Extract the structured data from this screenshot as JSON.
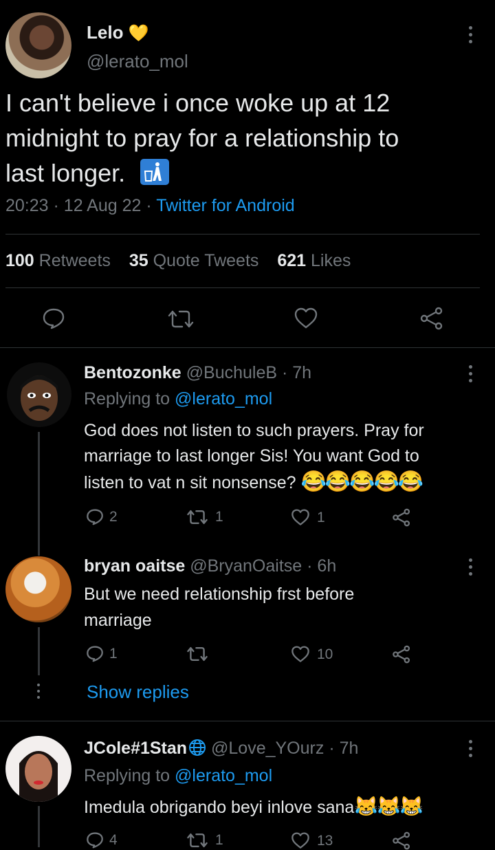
{
  "tweet": {
    "author_name": "Lelo",
    "author_handle": "@lerato_mol",
    "name_emoji": "💛",
    "text_lines": [
      "I can't believe i once woke up at 12",
      "midnight to pray for a relationship to",
      "last longer."
    ],
    "text_emoji": "🚮",
    "time": "20:23",
    "date": "12 Aug 22",
    "sep": "·",
    "source": "Twitter for Android",
    "stats": {
      "retweets_count": "100",
      "retweets_label": "Retweets",
      "quotes_count": "35",
      "quotes_label": "Quote Tweets",
      "likes_count": "621",
      "likes_label": "Likes"
    }
  },
  "replies": [
    {
      "name": "Bentozonke",
      "handle": "@BuchuleB",
      "age": "· 7h",
      "replying_prefix": "Replying to",
      "replying_handle": "@lerato_mol",
      "lines": [
        "God does not listen to such prayers. Pray for",
        "marriage to last longer Sis! You want God to",
        "listen to vat n sit nonsense?"
      ],
      "emoji": "😂😂😂😂😂",
      "reply_count": "2",
      "retweet_count": "1",
      "like_count": "1"
    },
    {
      "name": "bryan oaitse",
      "handle": "@BryanOaitse",
      "age": "· 6h",
      "lines": [
        "But we need relationship frst before",
        "marriage"
      ],
      "reply_count": "1",
      "retweet_count": "",
      "like_count": "10",
      "show_replies": "Show replies"
    },
    {
      "name": "JCole#1Stan",
      "handle": "@Love_YOurz",
      "age": "· 7h",
      "replying_prefix": "Replying to",
      "replying_handle": "@lerato_mol",
      "lines": [
        "Imedula obrigando beyi inlove sana"
      ],
      "emoji": "😹😹😹",
      "reply_count": "4",
      "retweet_count": "1",
      "like_count": "13"
    }
  ],
  "colors": {
    "background": "#000000",
    "text": "#e7e9ea",
    "muted": "#71767b",
    "link": "#1d9bf0",
    "divider": "#2f3336"
  }
}
